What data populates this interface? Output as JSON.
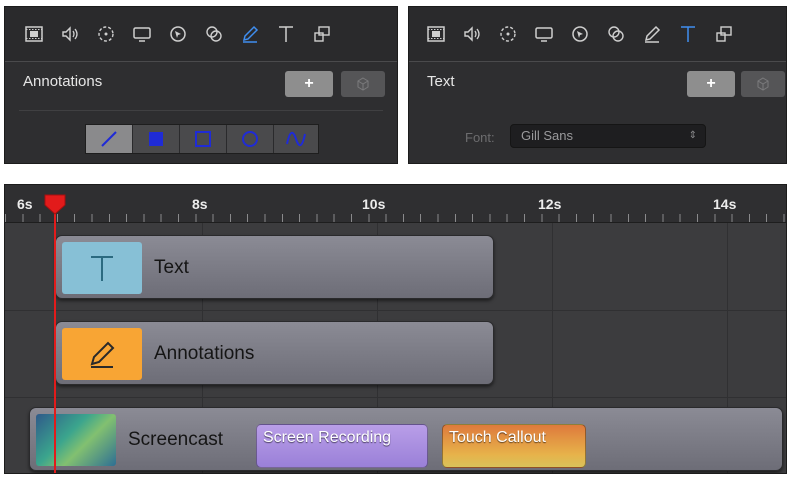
{
  "annotations_panel": {
    "title": "Annotations",
    "add_label": "+",
    "tools": [
      "video-icon",
      "audio-icon",
      "cursor-icon",
      "screen-icon",
      "touch-icon",
      "callout-icon",
      "pencil-icon",
      "text-icon",
      "layers-icon"
    ],
    "active_tool": "pencil-icon",
    "shapes": [
      "line",
      "filled-rectangle",
      "rectangle",
      "ellipse",
      "curve"
    ],
    "selected_shape": "line",
    "shape_color": "#1f2bd6"
  },
  "text_panel": {
    "title": "Text",
    "add_label": "+",
    "active_tool": "text-icon",
    "font_label": "Font:",
    "font_value": "Gill Sans"
  },
  "timeline": {
    "ticks": [
      "6s",
      "8s",
      "10s",
      "12s",
      "14s"
    ],
    "tracks": [
      {
        "label": "Text",
        "icon": "T"
      },
      {
        "label": "Annotations",
        "icon": "pencil-icon"
      },
      {
        "label": "Screencast"
      }
    ],
    "clips": [
      {
        "label": "Screen Recording",
        "color": "#b59bea"
      },
      {
        "label": "Touch Callout",
        "color": "#e49240"
      }
    ],
    "playhead_color": "#e21b1b",
    "accent": "#3f8ef0"
  }
}
